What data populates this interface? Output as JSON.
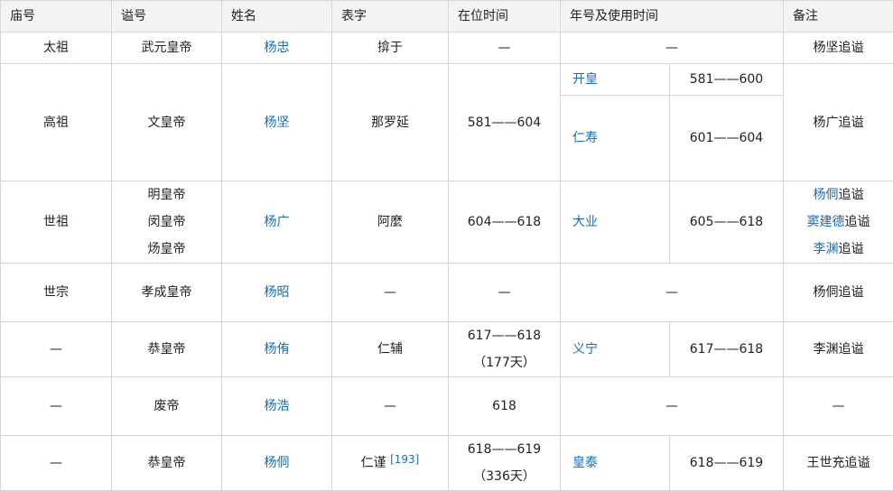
{
  "headers": [
    "庙号",
    "谥号",
    "姓名",
    "表字",
    "在位时间",
    "年号及使用时间",
    "备注"
  ],
  "rows": [
    {
      "miao": "太祖",
      "shi": [
        "武元皇帝"
      ],
      "name": "杨忠",
      "zi": "揜于",
      "reign": "—",
      "era_span": "—",
      "note": [
        {
          "text": "杨坚追谥"
        }
      ]
    },
    {
      "miao": "高祖",
      "shi": [
        "文皇帝"
      ],
      "name": "杨坚",
      "zi": "那罗延",
      "reign": "581——604",
      "eras": [
        {
          "name": "开皇",
          "years": "581——600"
        },
        {
          "name": "仁寿",
          "years": "601——604"
        }
      ],
      "note": [
        {
          "text": "杨广追谥"
        }
      ]
    },
    {
      "miao": "世祖",
      "shi": [
        "明皇帝",
        "闵皇帝",
        "炀皇帝"
      ],
      "name": "杨广",
      "zi": "阿麼",
      "reign": "604——618",
      "eras": [
        {
          "name": "大业",
          "years": "605——618"
        }
      ],
      "note": [
        {
          "link": "杨侗",
          "text": "追谥"
        },
        {
          "link": "窦建德",
          "text": "追谥"
        },
        {
          "link": "李渊",
          "text": "追谥"
        }
      ]
    },
    {
      "miao": "世宗",
      "shi": [
        "孝成皇帝"
      ],
      "name": "杨昭",
      "zi": "—",
      "reign": "—",
      "era_span": "—",
      "note": [
        {
          "text": "杨侗追谥"
        }
      ]
    },
    {
      "miao": "—",
      "shi": [
        "恭皇帝"
      ],
      "name": "杨侑",
      "zi": "仁辅",
      "reign": "617——618",
      "reign2": "（177天）",
      "eras": [
        {
          "name": "义宁",
          "years": "617——618"
        }
      ],
      "note": [
        {
          "text": "李渊追谥"
        }
      ]
    },
    {
      "miao": "—",
      "shi": [
        "废帝"
      ],
      "name": "杨浩",
      "zi": "—",
      "reign": "618",
      "era_span": "—",
      "note": [
        {
          "text": "—"
        }
      ]
    },
    {
      "miao": "—",
      "shi": [
        "恭皇帝"
      ],
      "name": "杨侗",
      "zi": "仁谨",
      "ref": "[193]",
      "reign": "618——619",
      "reign2": "（336天）",
      "eras": [
        {
          "name": "皇泰",
          "years": "618——619"
        }
      ],
      "note": [
        {
          "text": "王世充追谥"
        }
      ]
    }
  ]
}
